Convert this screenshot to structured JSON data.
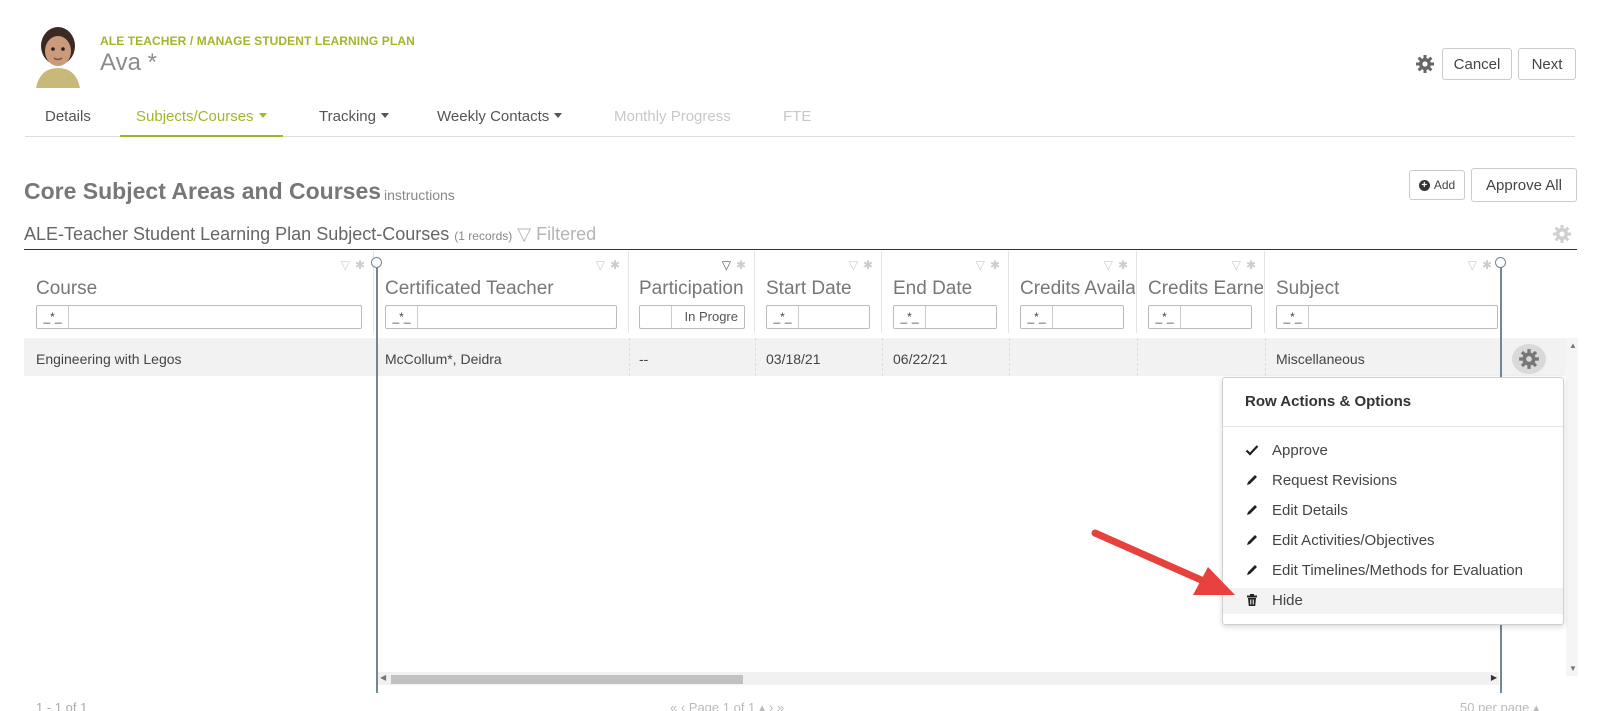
{
  "header": {
    "breadcrumb": "ALE TEACHER / MANAGE STUDENT LEARNING PLAN",
    "student_name": "Ava *",
    "cancel_label": "Cancel",
    "next_label": "Next"
  },
  "tabs": [
    {
      "label": "Details",
      "state": "normal",
      "dropdown": false
    },
    {
      "label": "Subjects/Courses",
      "state": "active",
      "dropdown": true
    },
    {
      "label": "Tracking",
      "state": "normal",
      "dropdown": true
    },
    {
      "label": "Weekly Contacts",
      "state": "normal",
      "dropdown": true
    },
    {
      "label": "Monthly Progress",
      "state": "disabled",
      "dropdown": false
    },
    {
      "label": "FTE",
      "state": "disabled",
      "dropdown": false
    }
  ],
  "section": {
    "title": "Core Subject Areas and Courses",
    "instructions": "instructions",
    "add_label": "Add",
    "approve_all_label": "Approve All"
  },
  "grid": {
    "title": "ALE-Teacher Student Learning Plan Subject-Courses",
    "record_count": "(1 records)",
    "filter_status": "Filtered",
    "columns": [
      {
        "label": "Course",
        "filter_op": "_*_",
        "filter_value": ""
      },
      {
        "label": "Certificated Teacher",
        "filter_op": "_*_",
        "filter_value": ""
      },
      {
        "label": "Participation",
        "filter_op": "",
        "filter_value": "In Progre"
      },
      {
        "label": "Start Date",
        "filter_op": "_*_",
        "filter_value": ""
      },
      {
        "label": "End Date",
        "filter_op": "_*_",
        "filter_value": ""
      },
      {
        "label": "Credits Availa",
        "filter_op": "_*_",
        "filter_value": ""
      },
      {
        "label": "Credits Earne",
        "filter_op": "_*_",
        "filter_value": ""
      },
      {
        "label": "Subject",
        "filter_op": "_*_",
        "filter_value": ""
      }
    ],
    "rows": [
      {
        "course": "Engineering with Legos",
        "teacher": "McCollum*, Deidra",
        "participation": "--",
        "start_date": "03/18/21",
        "end_date": "06/22/21",
        "credits_available": "",
        "credits_earned": "",
        "subject": "Miscellaneous"
      }
    ]
  },
  "row_menu": {
    "title": "Row Actions & Options",
    "items": [
      {
        "label": "Approve",
        "icon": "check-icon"
      },
      {
        "label": "Request Revisions",
        "icon": "pencil-icon"
      },
      {
        "label": "Edit Details",
        "icon": "pencil-icon"
      },
      {
        "label": "Edit Activities/Objectives",
        "icon": "pencil-icon"
      },
      {
        "label": "Edit Timelines/Methods for Evaluation",
        "icon": "pencil-icon"
      },
      {
        "label": "Hide",
        "icon": "trash-icon"
      }
    ]
  },
  "footer": {
    "count": "1 - 1 of 1",
    "pager": "«   ‹   Page 1 of 1 ▴   ›   »",
    "per_page": "50 per page ▴"
  },
  "colors": {
    "accent": "#a6b42a",
    "annotation_arrow": "#e8403c"
  }
}
